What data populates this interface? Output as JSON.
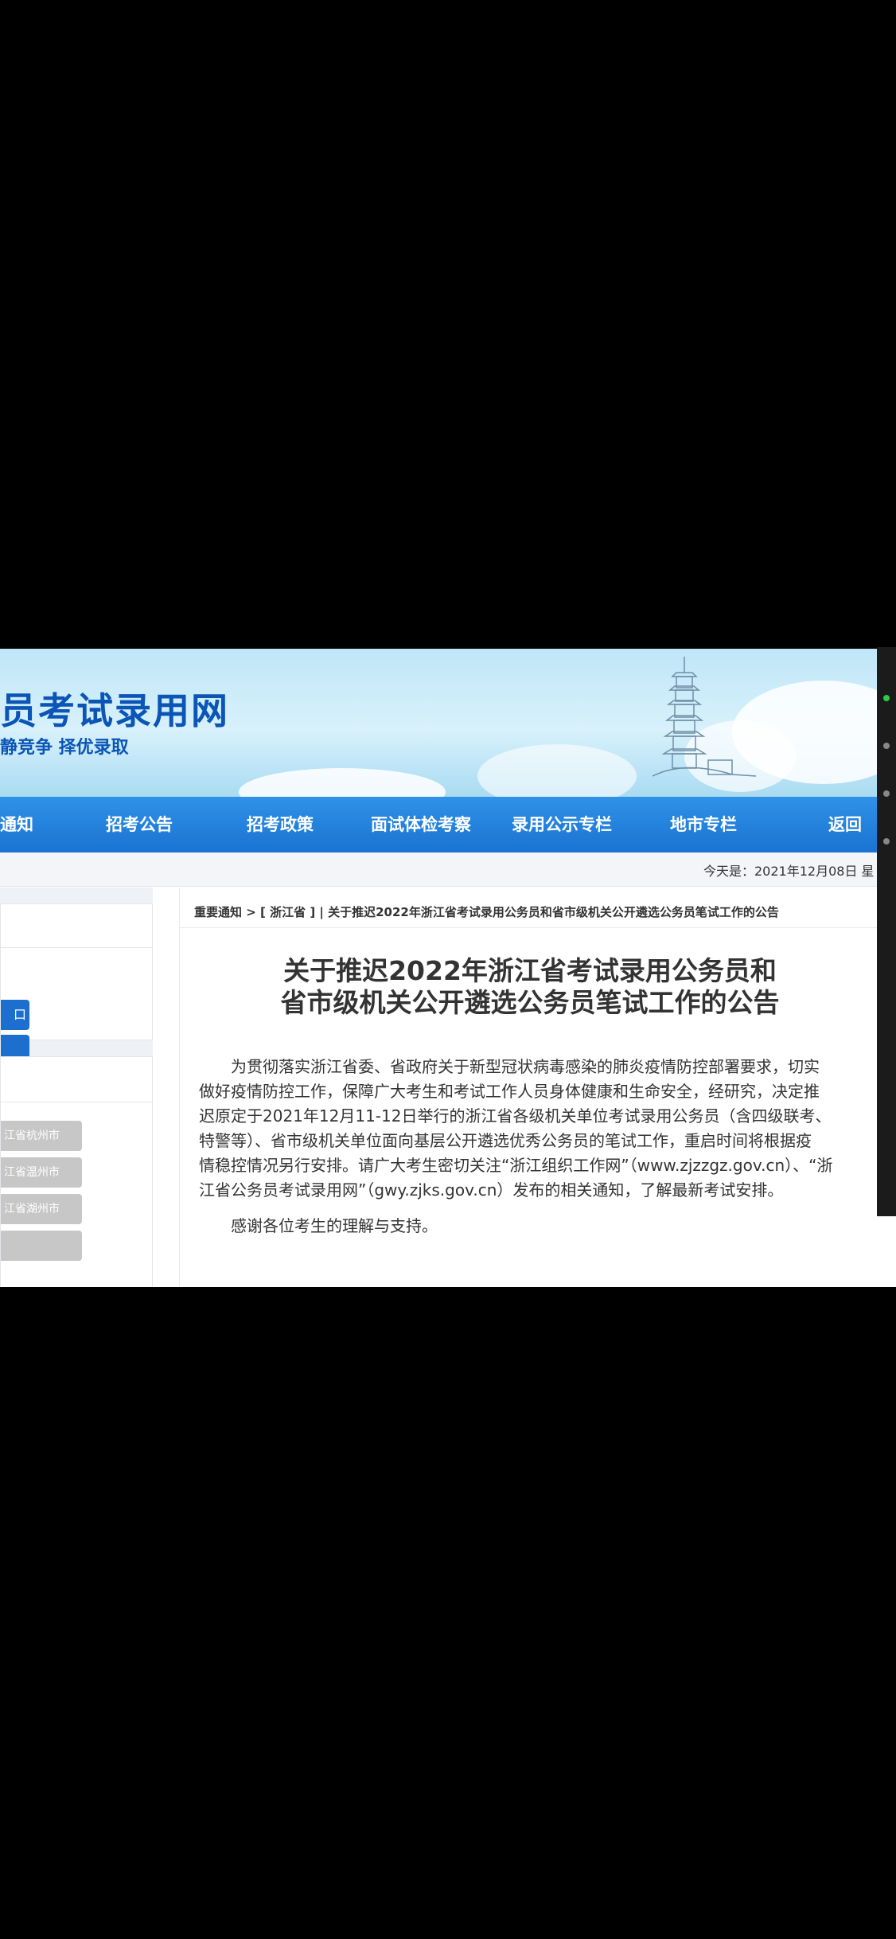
{
  "header": {
    "title": "员考试录用网",
    "slogan": "静竞争 择优录取"
  },
  "nav": {
    "items": [
      "通知",
      "招考公告",
      "招考政策",
      "面试体检考察",
      "录用公示专栏",
      "地市专栏",
      "返回"
    ]
  },
  "datebar": {
    "text": "今天是：2021年12月08日 星"
  },
  "sidebar": {
    "login_buttons": [
      "口",
      ""
    ],
    "city_buttons": [
      "江省杭州市",
      "江省温州市",
      "江省湖州市"
    ]
  },
  "article": {
    "breadcrumb": "重要通知 > [ 浙江省 ] | 关于推迟2022年浙江省考试录用公务员和省市级机关公开遴选公务员笔试工作的公告",
    "title_line1": "关于推迟2022年浙江省考试录用公务员和",
    "title_line2": "省市级机关公开遴选公务员笔试工作的公告",
    "para_lines": [
      "　　为贯彻落实浙江省委、省政府关于新型冠状病毒感染的肺炎疫情防控部署要求，切实",
      "做好疫情防控工作，保障广大考生和考试工作人员身体健康和生命安全，经研究，决定推",
      "迟原定于2021年12月11-12日举行的浙江省各级机关单位考试录用公务员（含四级联考、",
      "特警等）、省市级机关单位面向基层公开遴选优秀公务员的笔试工作，重启时间将根据疫",
      "情稳控情况另行安排。请广大考生密切关注“浙江组织工作网”（www.zjzzgz.gov.cn）、“浙",
      "江省公务员考试录用网”（gwy.zjks.gov.cn）发布的相关通知，了解最新考试安排。"
    ],
    "thanks": "　　感谢各位考生的理解与支持。"
  },
  "colors": {
    "nav_blue": "#1a73d1",
    "title_blue": "#0b55b7",
    "background": "#000000"
  }
}
